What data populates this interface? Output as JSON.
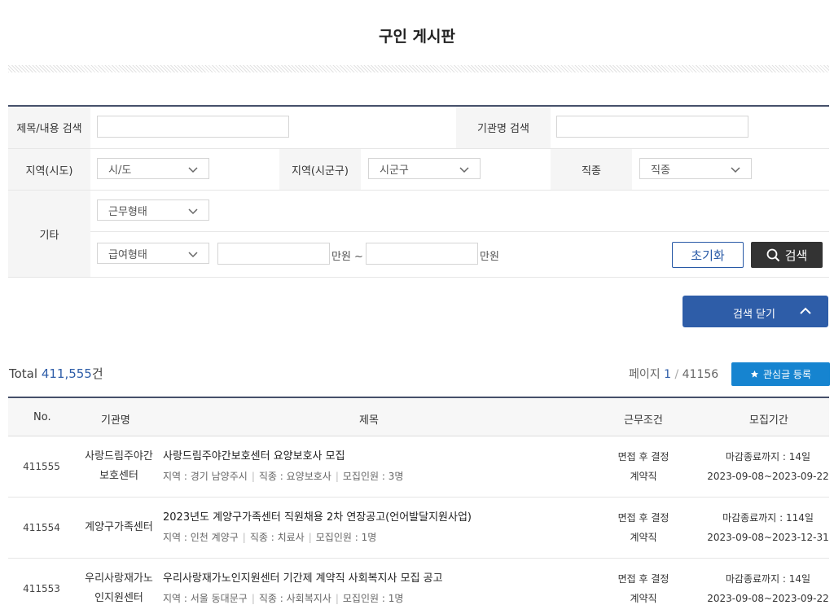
{
  "page_title": "구인 게시판",
  "search": {
    "title_content_label": "제목/내용 검색",
    "org_name_label": "기관명 검색",
    "region_sido_label": "지역(시도)",
    "region_sido_value": "시/도",
    "region_sigungu_label": "지역(시군구)",
    "region_sigungu_value": "시군구",
    "job_type_label": "직종",
    "job_type_value": "직종",
    "etc_label": "기타",
    "work_type_value": "근무형태",
    "pay_type_value": "급여형태",
    "unit_from": "만원 ~",
    "unit_to": "만원",
    "reset_label": "초기화",
    "search_label": "검색",
    "close_label": "검색 닫기"
  },
  "summary": {
    "total_prefix": "Total ",
    "total_count": "411,555",
    "total_suffix": "건",
    "page_prefix": "페이지 ",
    "page_current": "1",
    "page_sep": "/",
    "page_total": "41156",
    "favorite_label": "관심글 등록"
  },
  "table": {
    "headers": {
      "no": "No.",
      "org": "기관명",
      "title": "제목",
      "condition": "근무조건",
      "period": "모집기간"
    },
    "rows": [
      {
        "no": "411555",
        "org_line1": "사랑드림주야간",
        "org_line2": "보호센터",
        "title": "사랑드림주야간보호센터 요양보호사 모집",
        "region": "지역 : 경기 남양주시",
        "job": "직종 : 요양보호사",
        "headcount": "모집인원 : 3명",
        "cond1": "면접 후 결정",
        "cond2": "계약직",
        "deadline": "마감종료까지 : 14일",
        "dates": "2023-09-08~2023-09-22"
      },
      {
        "no": "411554",
        "org_line1": "계양구가족센터",
        "org_line2": "",
        "title": "2023년도 계양구가족센터 직원채용 2차 연장공고(언어발달지원사업)",
        "region": "지역 : 인천 계양구",
        "job": "직종 : 치료사",
        "headcount": "모집인원 : 1명",
        "cond1": "면접 후 결정",
        "cond2": "계약직",
        "deadline": "마감종료까지 : 114일",
        "dates": "2023-09-08~2023-12-31"
      },
      {
        "no": "411553",
        "org_line1": "우리사랑재가노",
        "org_line2": "인지원센터",
        "title": "우리사랑재가노인지원센터 기간제 계약직 사회복지사 모집 공고",
        "region": "지역 : 서울 동대문구",
        "job": "직종 : 사회복지사",
        "headcount": "모집인원 : 1명",
        "cond1": "면접 후 결정",
        "cond2": "계약직",
        "deadline": "마감종료까지 : 14일",
        "dates": "2023-09-08~2023-09-22"
      }
    ]
  },
  "colors": {
    "accent": "#2e5da8",
    "favorite": "#1684d0",
    "dark_button": "#333333",
    "border_dark": "#46506a"
  },
  "icons": [
    "chevron-down-icon",
    "search-icon",
    "chevron-up-icon",
    "star-icon"
  ]
}
